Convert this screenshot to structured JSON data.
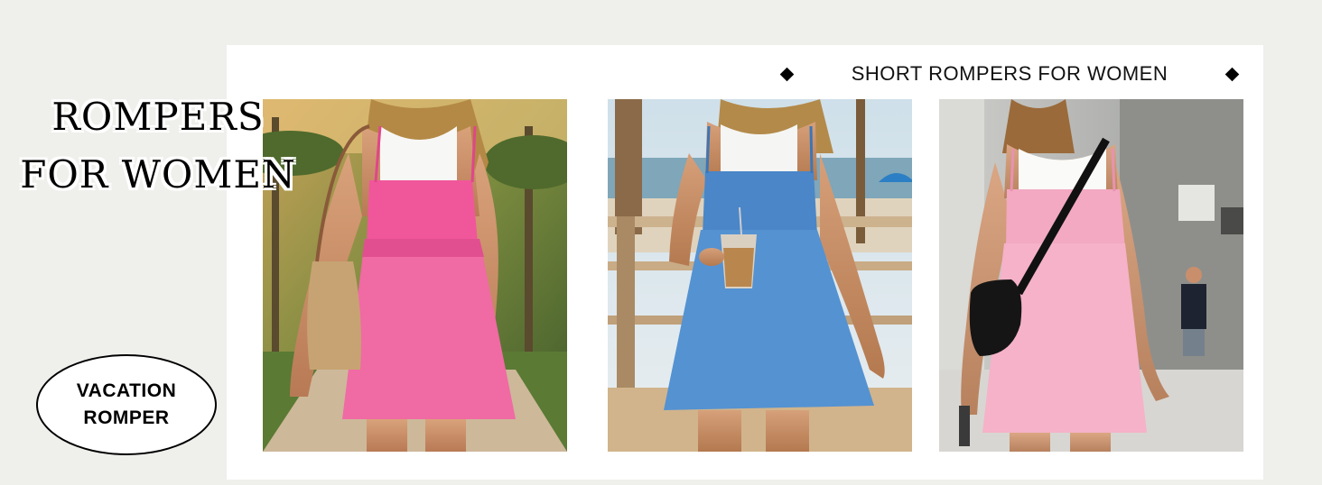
{
  "banner": {
    "title_line1": "ROMPERS",
    "title_line2": "FOR WOMEN",
    "badge_line1": "VACATION",
    "badge_line2": "ROMPER",
    "section_title": "SHORT ROMPERS FOR WOMEN"
  },
  "products": [
    {
      "color_name": "pink",
      "romper_color": "#f0579a",
      "scene": "tropical-palms"
    },
    {
      "color_name": "blue",
      "romper_color": "#4a86c8",
      "scene": "beach-boardwalk"
    },
    {
      "color_name": "light-pink",
      "romper_color": "#f3a9c1",
      "scene": "city-street"
    }
  ],
  "colors": {
    "background": "#eff0ec",
    "panel": "#ffffff",
    "text": "#000000"
  }
}
